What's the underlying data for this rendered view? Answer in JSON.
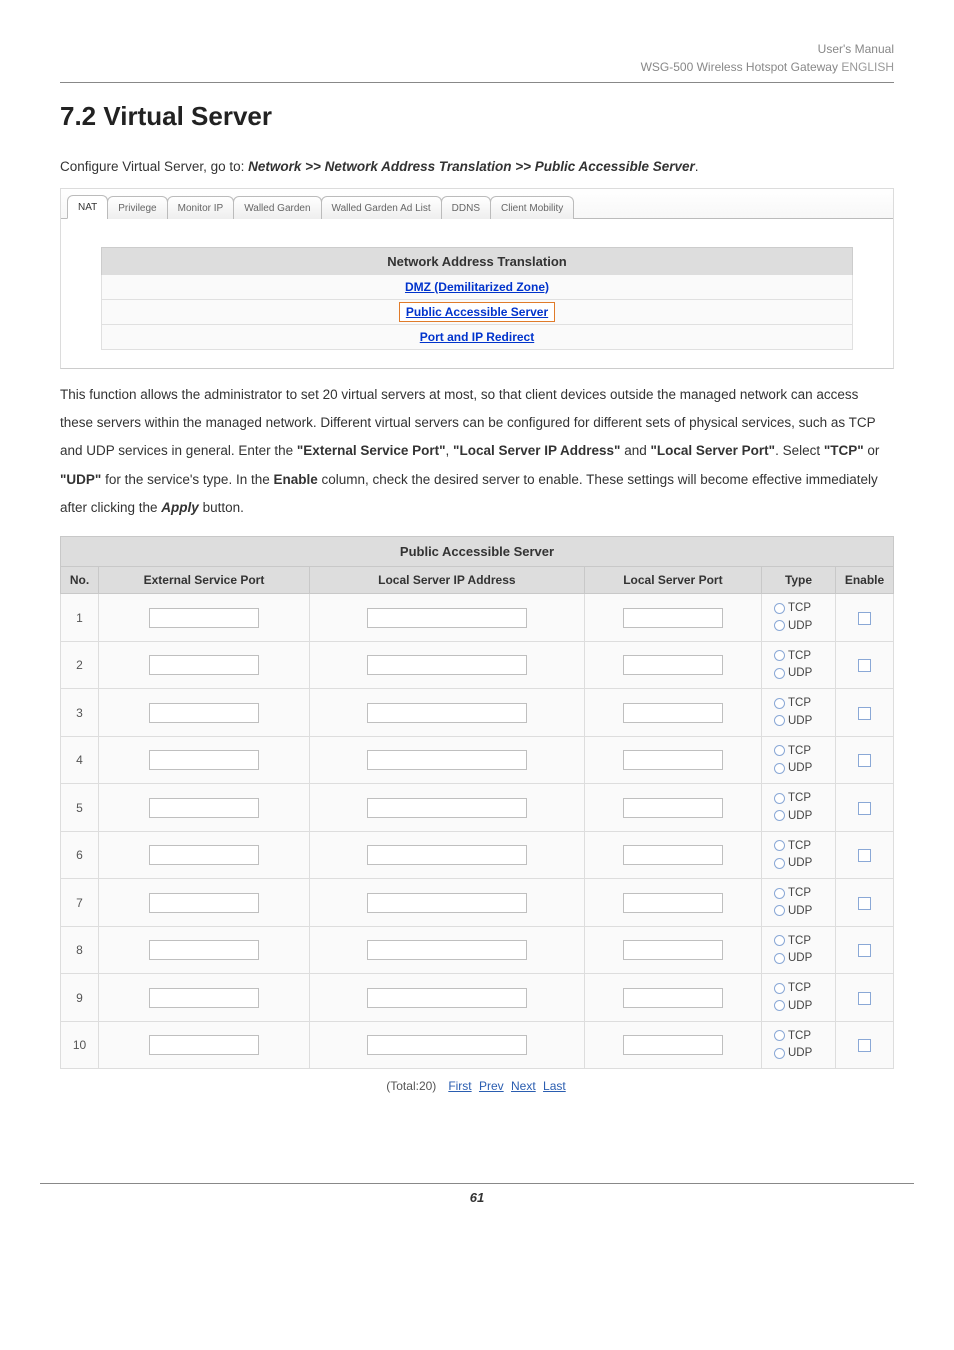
{
  "meta": {
    "manual_title": "User's Manual",
    "product_line": "WSG-500 Wireless Hotspot Gateway",
    "lang_suffix": "ENGLISH",
    "page_number": "61"
  },
  "heading": "7.2  Virtual Server",
  "intro": {
    "line1_prefix": "Configure Virtual Server, go to: ",
    "path": "Network >> Network Address Translation >> Public Accessible Server",
    "period": "."
  },
  "tabs": [
    "NAT",
    "Privilege",
    "Monitor IP",
    "Walled Garden",
    "Walled Garden Ad List",
    "DDNS",
    "Client Mobility"
  ],
  "nat_panel": {
    "title": "Network Address Translation",
    "links": [
      {
        "label": "DMZ (Demilitarized Zone)",
        "selected": false
      },
      {
        "label": "Public Accessible Server",
        "selected": true
      },
      {
        "label": "Port and IP Redirect",
        "selected": false
      }
    ]
  },
  "body_paragraph": {
    "p1": "This function allows the administrator to set 20 virtual servers at most, so that client devices outside the managed network can access these servers within the managed network. Different virtual servers can be configured for different sets of physical services, such as TCP and UDP services in general.",
    "p2_prefix": "Enter the ",
    "q1": "\"External Service Port\"",
    "comma1": ", ",
    "q2": "\"Local Server IP Address\"",
    "and": " and ",
    "q3": "\"Local Server Port\"",
    "p2_mid": ". Select ",
    "q4": "\"TCP\"",
    "or": " or ",
    "q5": "\"UDP\"",
    "p2_mid2": " for the service's type. In the ",
    "enable_b": "Enable",
    "p2_mid3": " column, check the desired server to enable. These settings will become effective immediately after clicking the ",
    "apply_bi": "Apply",
    "p2_end": " button."
  },
  "pas_table": {
    "title": "Public Accessible Server",
    "headers": [
      "No.",
      "External Service Port",
      "Local Server IP Address",
      "Local Server Port",
      "Type",
      "Enable"
    ],
    "type_labels": {
      "tcp": "TCP",
      "udp": "UDP"
    },
    "rows": [
      1,
      2,
      3,
      4,
      5,
      6,
      7,
      8,
      9,
      10
    ]
  },
  "pager": {
    "total_label": "(Total:20)",
    "links": [
      "First",
      "Prev",
      "Next",
      "Last"
    ]
  }
}
